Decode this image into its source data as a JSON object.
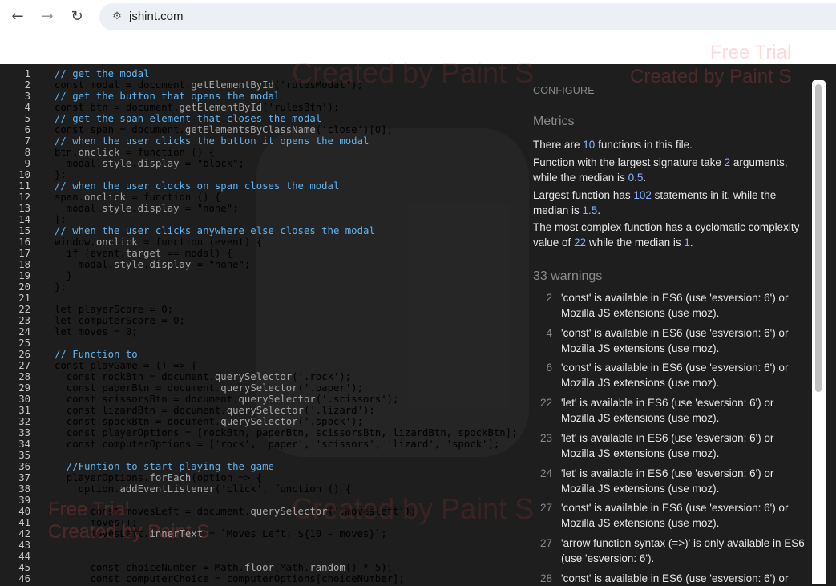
{
  "browser": {
    "url": "jshint.com",
    "back_icon": "←",
    "forward_icon": "→",
    "reload_icon": "↻",
    "site_info_icon": "⚙"
  },
  "watermarks": [
    "Free Trial",
    "Created by Paint S",
    "Created by Paint S",
    "Free Trial",
    "Created by Paint S",
    "Created by Paint S"
  ],
  "editor": {
    "lines": [
      {
        "n": "1",
        "t": "// get the modal"
      },
      {
        "n": "2",
        "t": "const modal = document.getElementById('rulesModal');"
      },
      {
        "n": "3",
        "t": "// get the button that opens the modal"
      },
      {
        "n": "4",
        "t": "const btn = document.getElementById('rulesBtn');"
      },
      {
        "n": "5",
        "t": "// get the span element that closes the modal"
      },
      {
        "n": "6",
        "t": "const span = document.getElementsByClassName('close')[0];"
      },
      {
        "n": "7",
        "t": "// when the user clicks the button it opens the modal"
      },
      {
        "n": "8",
        "t": "btn.onclick = function () {"
      },
      {
        "n": "9",
        "t": "  modal.style.display = \"block\";"
      },
      {
        "n": "10",
        "t": "};"
      },
      {
        "n": "11",
        "t": "// when the user clocks on span closes the modal"
      },
      {
        "n": "12",
        "t": "span.onclick = function () {"
      },
      {
        "n": "13",
        "t": "  modal.style.display = \"none\";"
      },
      {
        "n": "14",
        "t": "};"
      },
      {
        "n": "15",
        "t": "// when the user clicks anywhere else closes the modal"
      },
      {
        "n": "16",
        "t": "window.onclick = function (event) {"
      },
      {
        "n": "17",
        "t": "  if (event.target == modal) {"
      },
      {
        "n": "18",
        "t": "    modal.style.display = \"none\";"
      },
      {
        "n": "19",
        "t": "  }"
      },
      {
        "n": "20",
        "t": "};"
      },
      {
        "n": "21",
        "t": ""
      },
      {
        "n": "22",
        "t": "let playerScore = 0;"
      },
      {
        "n": "23",
        "t": "let computerScore = 0;"
      },
      {
        "n": "24",
        "t": "let moves = 0;"
      },
      {
        "n": "25",
        "t": ""
      },
      {
        "n": "26",
        "t": "// Function to"
      },
      {
        "n": "27",
        "t": "const playGame = () => {"
      },
      {
        "n": "28",
        "t": "  const rockBtn = document.querySelector('.rock');"
      },
      {
        "n": "29",
        "t": "  const paperBtn = document.querySelector('.paper');"
      },
      {
        "n": "30",
        "t": "  const scissorsBtn = document.querySelector('.scissors');"
      },
      {
        "n": "31",
        "t": "  const lizardBtn = document.querySelector('.lizard');"
      },
      {
        "n": "32",
        "t": "  const spockBtn = document.querySelector('.spock');"
      },
      {
        "n": "33",
        "t": "  const playerOptions = [rockBtn, paperBtn, scissorsBtn, lizardBtn, spockBtn];"
      },
      {
        "n": "34",
        "t": "  const computerOptions = ['rock', 'paper', 'scissors', 'lizard', 'spock'];"
      },
      {
        "n": "35",
        "t": ""
      },
      {
        "n": "36",
        "t": "  //Funtion to start playing the game"
      },
      {
        "n": "37",
        "t": "  playerOptions.forEach(option => {"
      },
      {
        "n": "38",
        "t": "    option.addEventListener('click', function () {"
      },
      {
        "n": "39",
        "t": ""
      },
      {
        "n": "40",
        "t": "      const movesLeft = document.querySelector('.movesleft');"
      },
      {
        "n": "41",
        "t": "      moves++;"
      },
      {
        "n": "42",
        "t": "      movesLeft.innerText = `Moves Left: ${10 - moves}`;"
      },
      {
        "n": "43",
        "t": ""
      },
      {
        "n": "44",
        "t": ""
      },
      {
        "n": "45",
        "t": "      const choiceNumber = Math.floor(Math.random() * 5);"
      },
      {
        "n": "46",
        "t": "      const computerChoice = computerOptions[choiceNumber];"
      }
    ]
  },
  "sidebar": {
    "configure": "CONFIGURE",
    "metrics_title": "Metrics",
    "metrics": [
      {
        "before": "There are ",
        "num": "10",
        "after": " functions in this file."
      },
      {
        "before": "Function with the largest signature take ",
        "num": "2",
        "after": " arguments, while the median is ",
        "num2": "0.5",
        "after2": "."
      },
      {
        "before": "Largest function has ",
        "num": "102",
        "after": " statements in it, while the median is ",
        "num2": "1.5",
        "after2": "."
      },
      {
        "before": "The most complex function has a cyclomatic complexity value of ",
        "num": "22",
        "after": " while the median is ",
        "num2": "1",
        "after2": "."
      }
    ],
    "warnings_title": "33 warnings",
    "warnings": [
      {
        "line": "2",
        "text": "'const' is available in ES6 (use 'esversion: 6') or Mozilla JS extensions (use moz)."
      },
      {
        "line": "4",
        "text": "'const' is available in ES6 (use 'esversion: 6') or Mozilla JS extensions (use moz)."
      },
      {
        "line": "6",
        "text": "'const' is available in ES6 (use 'esversion: 6') or Mozilla JS extensions (use moz)."
      },
      {
        "line": "22",
        "text": "'let' is available in ES6 (use 'esversion: 6') or Mozilla JS extensions (use moz)."
      },
      {
        "line": "23",
        "text": "'let' is available in ES6 (use 'esversion: 6') or Mozilla JS extensions (use moz)."
      },
      {
        "line": "24",
        "text": "'let' is available in ES6 (use 'esversion: 6') or Mozilla JS extensions (use moz)."
      },
      {
        "line": "27",
        "text": "'const' is available in ES6 (use 'esversion: 6') or Mozilla JS extensions (use moz)."
      },
      {
        "line": "27",
        "text": "'arrow function syntax (=>)' is only available in ES6 (use 'esversion: 6')."
      },
      {
        "line": "28",
        "text": "'const' is available in ES6 (use 'esversion: 6') or"
      }
    ]
  }
}
